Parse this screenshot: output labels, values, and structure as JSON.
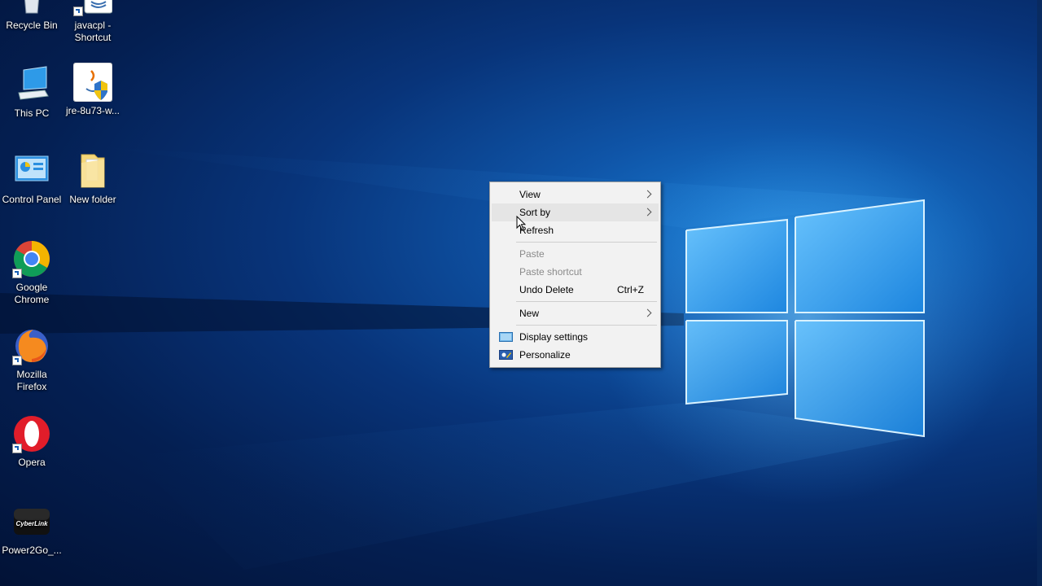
{
  "desktop": {
    "icons": [
      {
        "label": "Recycle Bin",
        "icon": "recycle-bin-icon",
        "shortcut": false
      },
      {
        "label": "javacpl - Shortcut",
        "icon": "java-control-panel-icon",
        "shortcut": true
      },
      {
        "label": "This PC",
        "icon": "this-pc-icon",
        "shortcut": false
      },
      {
        "label": "jre-8u73-w...",
        "icon": "java-installer-icon",
        "shortcut": false
      },
      {
        "label": "Control Panel",
        "icon": "control-panel-icon",
        "shortcut": false
      },
      {
        "label": "New folder",
        "icon": "folder-icon",
        "shortcut": false
      },
      {
        "label": "Google Chrome",
        "icon": "chrome-icon",
        "shortcut": true
      },
      {
        "label": "Mozilla Firefox",
        "icon": "firefox-icon",
        "shortcut": true
      },
      {
        "label": "Opera",
        "icon": "opera-icon",
        "shortcut": true
      },
      {
        "label": "Power2Go_...",
        "icon": "cyberlink-icon",
        "shortcut": false
      }
    ],
    "cyberlink_logo_text": "CyberLink"
  },
  "context_menu": {
    "view": {
      "label": "View"
    },
    "sort_by": {
      "label": "Sort by"
    },
    "refresh": {
      "label": "Refresh"
    },
    "paste": {
      "label": "Paste"
    },
    "paste_shortcut": {
      "label": "Paste shortcut"
    },
    "undo_delete": {
      "label": "Undo Delete",
      "shortcut": "Ctrl+Z"
    },
    "new": {
      "label": "New"
    },
    "display_settings": {
      "label": "Display settings",
      "icon": "display-icon"
    },
    "personalize": {
      "label": "Personalize",
      "icon": "personalize-icon"
    }
  },
  "colors": {
    "wallpaper_dark": "#041f52",
    "wallpaper_light": "#1a7fd6",
    "menu_background": "#f2f2f2",
    "menu_hover": "#e5e5e5",
    "menu_disabled_text": "#8a8a8a"
  }
}
